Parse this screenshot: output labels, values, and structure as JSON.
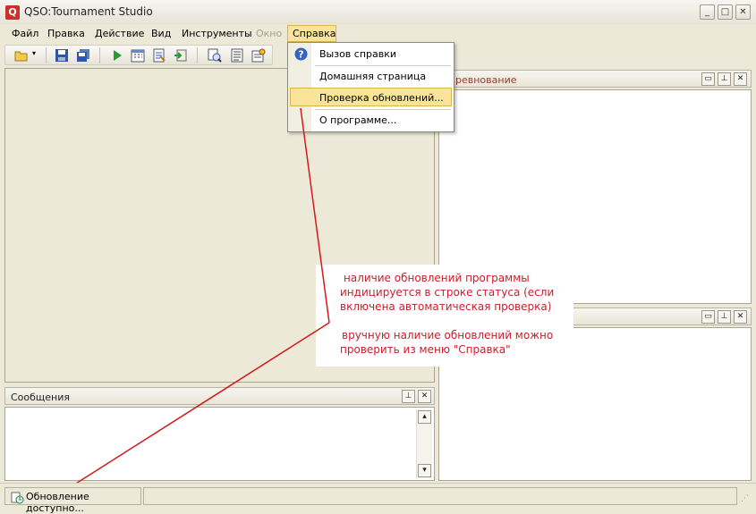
{
  "window": {
    "title": "QSO:Tournament Studio",
    "app_icon_letter": "Q",
    "minimize": "_",
    "maximize": "□",
    "close": "✕"
  },
  "menu": {
    "items": [
      "Файл",
      "Правка",
      "Действие",
      "Вид",
      "Инструменты",
      "Окно",
      "Справка"
    ],
    "active": "Справка",
    "disabled": [
      "Окно"
    ]
  },
  "help_menu": {
    "items": [
      "Вызов справки",
      "Домашняя страница",
      "Проверка обновлений...",
      "О программе..."
    ],
    "highlighted": "Проверка обновлений..."
  },
  "panels": {
    "competition_title": "ревнование",
    "messages_title": "Сообщения"
  },
  "annotation": {
    "lines_1": [
      "наличие обновлений программы",
      "индицируется в строке статуса (если",
      "включена автоматическая проверка)"
    ],
    "lines_2": [
      "вручную наличие обновлений можно",
      "проверить из меню \"Справка\""
    ],
    "color": "#c8202a"
  },
  "status": {
    "update_text": "Обновление доступно..."
  },
  "colors": {
    "accent": "#fbe49a",
    "chrome": "#ece9d8"
  }
}
